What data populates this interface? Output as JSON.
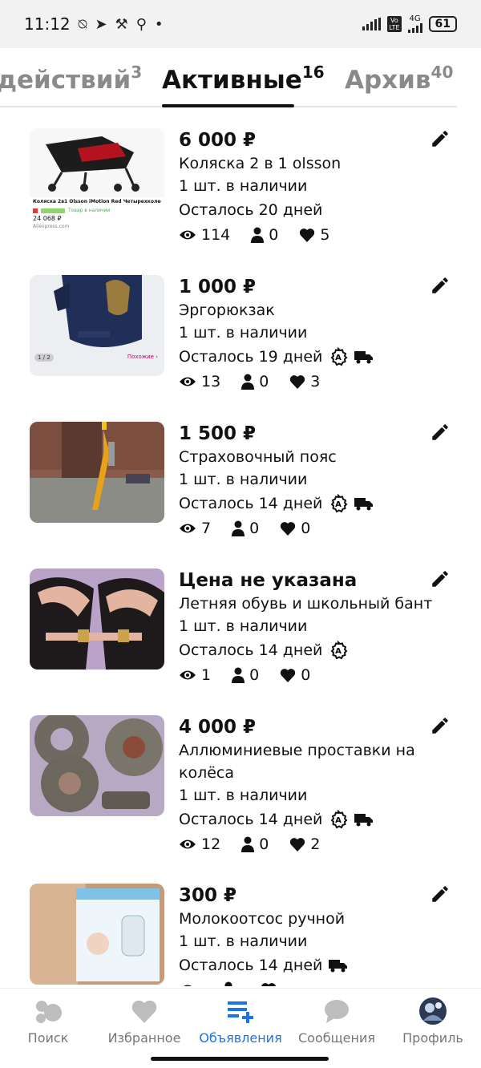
{
  "status_bar": {
    "time": "11:12",
    "network": "4G",
    "battery": "61"
  },
  "tabs": [
    {
      "label": "действий",
      "count": "3"
    },
    {
      "label": "Активные",
      "count": "16"
    },
    {
      "label": "Архив",
      "count": "40"
    }
  ],
  "listings": [
    {
      "price": "6 000 ₽",
      "title": "Коляска 2 в 1 olsson",
      "stock": "1 шт. в наличии",
      "remaining": "Осталось 20 дней",
      "views": "114",
      "contacts": "0",
      "likes": "5",
      "thumb_caption": "Коляска 2в1 Olsson iMotion Red Четырехколесная ко...",
      "thumb_price": "24 068 ₽",
      "thumb_badge": "Товар в наличии",
      "thumb_site": "Aliexpress.com"
    },
    {
      "price": "1 000 ₽",
      "title": "Эргорюкзак",
      "stock": "1 шт. в наличии",
      "remaining": "Осталось 19 дней",
      "views": "13",
      "contacts": "0",
      "likes": "3",
      "thumb_counter": "1 / 2",
      "thumb_more": "Похожие ›"
    },
    {
      "price": "1 500 ₽",
      "title": "Страховочный пояс",
      "stock": "1 шт. в наличии",
      "remaining": "Осталось 14 дней",
      "views": "7",
      "contacts": "0",
      "likes": "0"
    },
    {
      "price": "Цена не указана",
      "title": "Летняя обувь и школьный бант",
      "stock": "1 шт. в наличии",
      "remaining": "Осталось 14 дней",
      "views": "1",
      "contacts": "0",
      "likes": "0"
    },
    {
      "price": "4 000 ₽",
      "title": "Аллюминиевые проставки на колёса",
      "stock": "1 шт. в наличии",
      "remaining": "Осталось 14 дней",
      "views": "12",
      "contacts": "0",
      "likes": "2"
    },
    {
      "price": "300 ₽",
      "title": "Молокоотсос ручной",
      "stock": "1 шт. в наличии",
      "remaining": "Осталось 14 дней",
      "views": "",
      "contacts": "",
      "likes": ""
    }
  ],
  "bottom_nav": [
    {
      "label": "Поиск",
      "icon": "search-bubbles-icon"
    },
    {
      "label": "Избранное",
      "icon": "heart-icon"
    },
    {
      "label": "Объявления",
      "icon": "add-listing-icon"
    },
    {
      "label": "Сообщения",
      "icon": "chat-icon"
    },
    {
      "label": "Профиль",
      "icon": "avatar"
    }
  ],
  "colors": {
    "accent": "#1a73e8",
    "text": "#111111",
    "muted": "#8a8a8a"
  }
}
